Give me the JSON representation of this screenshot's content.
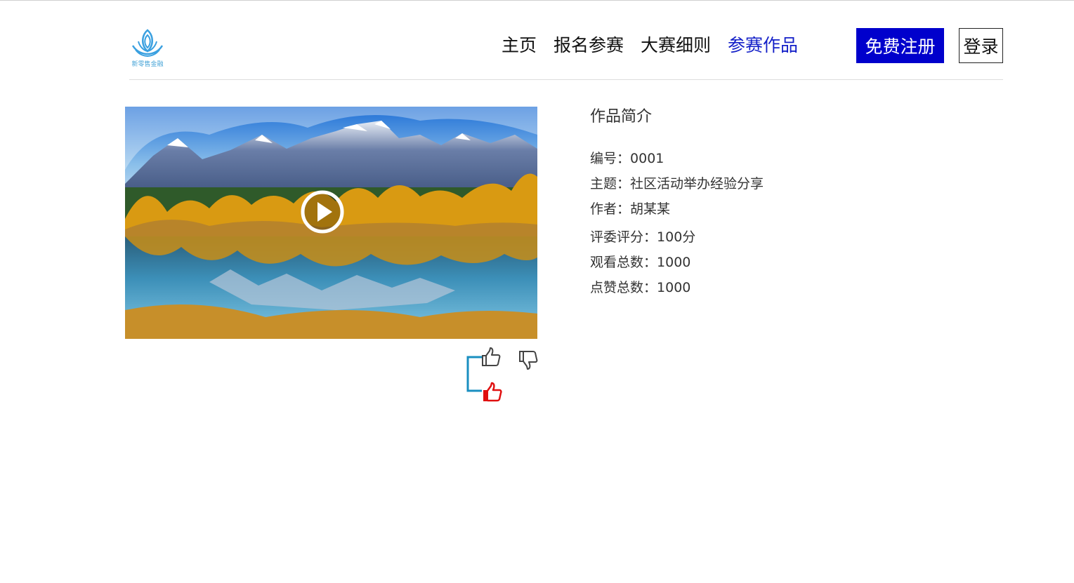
{
  "header": {
    "logo_text": "新零售金融",
    "nav": [
      {
        "label": "主页",
        "active": false
      },
      {
        "label": "报名参赛",
        "active": false
      },
      {
        "label": "大赛细则",
        "active": false
      },
      {
        "label": "参赛作品",
        "active": true
      }
    ],
    "register_label": "免费注册",
    "login_label": "登录"
  },
  "info": {
    "title": "作品简介",
    "id_label": "编号：",
    "id_value": "0001",
    "topic_label": "主题：",
    "topic_value": "社区活动举办经验分享",
    "author_label": "作者：",
    "author_value": "胡某某",
    "score_label": "评委评分：",
    "score_value": "100分",
    "views_label": "观看总数：",
    "views_value": "1000",
    "likes_label": "点赞总数：",
    "likes_value": "1000"
  },
  "icons": {
    "play": "play-icon",
    "like": "thumb-up-icon",
    "dislike": "thumb-down-icon",
    "liked": "thumb-up-filled-icon"
  },
  "colors": {
    "accent": "#0000cc",
    "active_nav": "#1420c8",
    "liked": "#e01010",
    "connector": "#1a8fc0"
  }
}
